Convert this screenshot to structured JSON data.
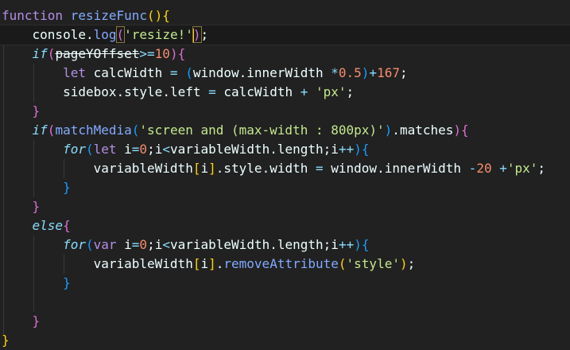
{
  "editor": {
    "current_line": 1,
    "lines": [
      {
        "indent": 0,
        "tokens": [
          [
            "function ",
            "kw"
          ],
          [
            "resizeFunc",
            "fn"
          ],
          [
            "()",
            "b1"
          ],
          [
            "{",
            "b1"
          ]
        ]
      },
      {
        "indent": 1,
        "tokens": [
          [
            "console",
            "id"
          ],
          [
            ".",
            "id"
          ],
          [
            "log",
            "fn"
          ],
          [
            "(",
            "b2m"
          ],
          [
            "'resize!'",
            "str"
          ],
          [
            "|",
            "cursor"
          ],
          [
            ")",
            "b2m"
          ],
          [
            ";",
            "id"
          ]
        ]
      },
      {
        "indent": 1,
        "tokens": [
          [
            "if",
            "ctl"
          ],
          [
            "(",
            "b2"
          ],
          [
            "pageYOffset",
            "dep"
          ],
          [
            ">=",
            "op"
          ],
          [
            "10",
            "num"
          ],
          [
            ")",
            "b2"
          ],
          [
            "{",
            "b2"
          ]
        ]
      },
      {
        "indent": 2,
        "tokens": [
          [
            "let ",
            "kw"
          ],
          [
            "calcWidth ",
            "id"
          ],
          [
            "= ",
            "op"
          ],
          [
            "(",
            "b3"
          ],
          [
            "window",
            "id"
          ],
          [
            ".",
            "id"
          ],
          [
            "innerWidth ",
            "id"
          ],
          [
            "*",
            "op"
          ],
          [
            "0.5",
            "num"
          ],
          [
            ")",
            "b3"
          ],
          [
            "+",
            "op"
          ],
          [
            "167",
            "num"
          ],
          [
            ";",
            "id"
          ]
        ]
      },
      {
        "indent": 2,
        "tokens": [
          [
            "sidebox",
            "id"
          ],
          [
            ".",
            "id"
          ],
          [
            "style",
            "id"
          ],
          [
            ".",
            "id"
          ],
          [
            "left ",
            "id"
          ],
          [
            "= ",
            "op"
          ],
          [
            "calcWidth ",
            "id"
          ],
          [
            "+ ",
            "op"
          ],
          [
            "'px'",
            "str"
          ],
          [
            ";",
            "id"
          ]
        ]
      },
      {
        "indent": 1,
        "tokens": [
          [
            "}",
            "b2"
          ]
        ]
      },
      {
        "indent": 1,
        "tokens": [
          [
            "if",
            "ctl"
          ],
          [
            "(",
            "b2"
          ],
          [
            "matchMedia",
            "fn"
          ],
          [
            "(",
            "b3"
          ],
          [
            "'screen and (max-width : 800px)'",
            "str"
          ],
          [
            ")",
            "b3"
          ],
          [
            ".",
            "id"
          ],
          [
            "matches",
            "id"
          ],
          [
            ")",
            "b2"
          ],
          [
            "{",
            "b2"
          ]
        ]
      },
      {
        "indent": 2,
        "tokens": [
          [
            "for",
            "ctl"
          ],
          [
            "(",
            "b3"
          ],
          [
            "let ",
            "kw"
          ],
          [
            "i",
            "id"
          ],
          [
            "=",
            "op"
          ],
          [
            "0",
            "num"
          ],
          [
            ";",
            "id"
          ],
          [
            "i",
            "id"
          ],
          [
            "<",
            "op"
          ],
          [
            "variableWidth",
            "id"
          ],
          [
            ".",
            "id"
          ],
          [
            "length",
            "id"
          ],
          [
            ";",
            "id"
          ],
          [
            "i",
            "id"
          ],
          [
            "++",
            "op"
          ],
          [
            ")",
            "b3"
          ],
          [
            "{",
            "b3"
          ]
        ]
      },
      {
        "indent": 3,
        "tokens": [
          [
            "variableWidth",
            "id"
          ],
          [
            "[",
            "b1"
          ],
          [
            "i",
            "id"
          ],
          [
            "]",
            "b1"
          ],
          [
            ".",
            "id"
          ],
          [
            "style",
            "id"
          ],
          [
            ".",
            "id"
          ],
          [
            "width ",
            "id"
          ],
          [
            "= ",
            "op"
          ],
          [
            "window",
            "id"
          ],
          [
            ".",
            "id"
          ],
          [
            "innerWidth ",
            "id"
          ],
          [
            "-",
            "op"
          ],
          [
            "20 ",
            "num"
          ],
          [
            "+",
            "op"
          ],
          [
            "'px'",
            "str"
          ],
          [
            ";",
            "id"
          ]
        ]
      },
      {
        "indent": 2,
        "tokens": [
          [
            "}",
            "b3"
          ]
        ]
      },
      {
        "indent": 1,
        "tokens": [
          [
            "}",
            "b2"
          ]
        ]
      },
      {
        "indent": 1,
        "tokens": [
          [
            "else",
            "ctl"
          ],
          [
            "{",
            "b2"
          ]
        ]
      },
      {
        "indent": 2,
        "tokens": [
          [
            "for",
            "ctl"
          ],
          [
            "(",
            "b3"
          ],
          [
            "var ",
            "kw"
          ],
          [
            "i",
            "id"
          ],
          [
            "=",
            "op"
          ],
          [
            "0",
            "num"
          ],
          [
            ";",
            "id"
          ],
          [
            "i",
            "id"
          ],
          [
            "<",
            "op"
          ],
          [
            "variableWidth",
            "id"
          ],
          [
            ".",
            "id"
          ],
          [
            "length",
            "id"
          ],
          [
            ";",
            "id"
          ],
          [
            "i",
            "id"
          ],
          [
            "++",
            "op"
          ],
          [
            ")",
            "b3"
          ],
          [
            "{",
            "b3"
          ]
        ]
      },
      {
        "indent": 3,
        "tokens": [
          [
            "variableWidth",
            "id"
          ],
          [
            "[",
            "b1"
          ],
          [
            "i",
            "id"
          ],
          [
            "]",
            "b1"
          ],
          [
            ".",
            "id"
          ],
          [
            "removeAttribute",
            "fn"
          ],
          [
            "(",
            "b1"
          ],
          [
            "'style'",
            "str"
          ],
          [
            ")",
            "b1"
          ],
          [
            ";",
            "id"
          ]
        ]
      },
      {
        "indent": 2,
        "tokens": [
          [
            "}",
            "b3"
          ]
        ]
      },
      {
        "indent": 0,
        "tokens": []
      },
      {
        "indent": 1,
        "tokens": [
          [
            "}",
            "b2"
          ]
        ]
      },
      {
        "indent": 0,
        "tokens": [
          [
            "}",
            "b1"
          ]
        ]
      }
    ]
  },
  "colors": {
    "background": "#212121",
    "cursor": "#ffcc00"
  }
}
